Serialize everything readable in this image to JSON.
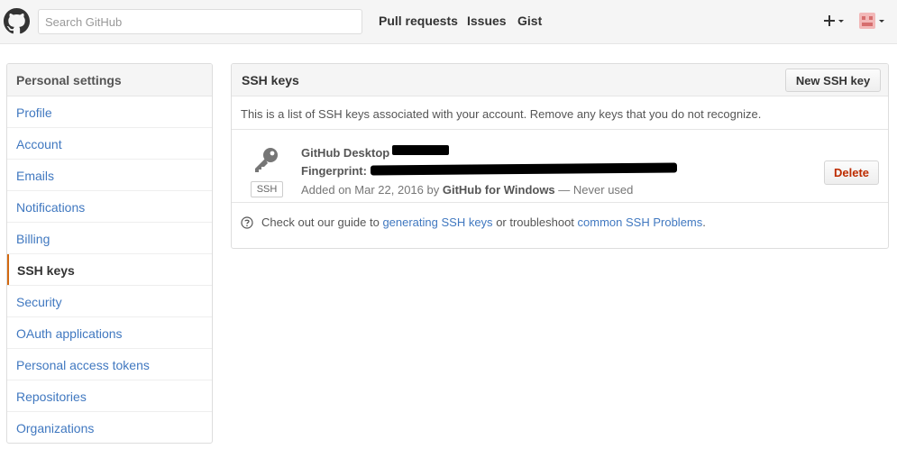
{
  "header": {
    "logo_icon": "octocat-icon",
    "search_placeholder": "Search GitHub",
    "nav": {
      "pull_requests": "Pull requests",
      "issues": "Issues",
      "gist": "Gist"
    },
    "plus_icon": "plus-dropdown-icon",
    "avatar_icon": "avatar-dropdown-icon"
  },
  "sidebar": {
    "title": "Personal settings",
    "items": [
      {
        "label": "Profile"
      },
      {
        "label": "Account"
      },
      {
        "label": "Emails"
      },
      {
        "label": "Notifications"
      },
      {
        "label": "Billing"
      },
      {
        "label": "SSH keys",
        "selected": true
      },
      {
        "label": "Security"
      },
      {
        "label": "OAuth applications"
      },
      {
        "label": "Personal access tokens"
      },
      {
        "label": "Repositories"
      },
      {
        "label": "Organizations"
      }
    ],
    "accent_color": "#d26911"
  },
  "main": {
    "title": "SSH keys",
    "new_button": "New SSH key",
    "intro": "This is a list of SSH keys associated with your account. Remove any keys that you do not recognize.",
    "key": {
      "icon": "key-icon",
      "type_label": "SSH",
      "title": "GitHub Desktop",
      "fingerprint_label": "Fingerprint:",
      "added_prefix": "Added on Mar 22, 2016 by",
      "added_by": "GitHub for Windows",
      "added_suffix": "— Never used",
      "delete_button": "Delete"
    },
    "footer": {
      "icon": "question-circle-icon",
      "text_before": "Check out our guide to",
      "link1": "generating SSH keys",
      "text_middle": "or troubleshoot",
      "link2": "common SSH Problems",
      "text_after": "."
    }
  },
  "colors": {
    "link": "#4078c0",
    "danger": "#bd2c00"
  }
}
